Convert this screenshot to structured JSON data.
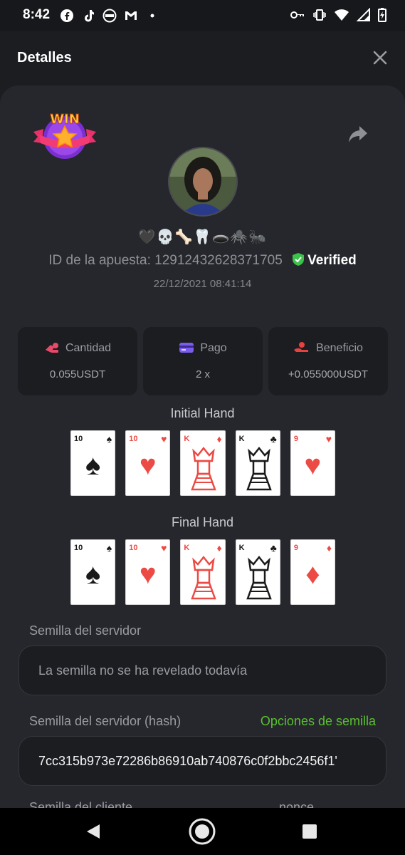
{
  "status_bar": {
    "time": "8:42"
  },
  "header": {
    "title": "Detalles"
  },
  "bet": {
    "emojis": "🖤💀🦴🦷🕳️🕷️🐜",
    "id_label": "ID de la apuesta: 12912432628371705",
    "verified_label": "Verified",
    "datetime": "22/12/2021 08:41:14"
  },
  "stats": [
    {
      "label": "Cantidad",
      "value": "0.055USDT",
      "icon": "coins-icon",
      "icon_color": "#e84a6a"
    },
    {
      "label": "Pago",
      "value": "2 x",
      "icon": "card-icon",
      "icon_color": "#7b5cf0"
    },
    {
      "label": "Beneficio",
      "value": "+0.055000USDT",
      "icon": "hand-coin-icon",
      "icon_color": "#e8413f"
    }
  ],
  "initial_hand": {
    "title": "Initial Hand",
    "cards": [
      {
        "rank": "10",
        "suit": "♠",
        "color": "black"
      },
      {
        "rank": "10",
        "suit": "♥",
        "color": "red"
      },
      {
        "rank": "K",
        "suit": "♦",
        "color": "red"
      },
      {
        "rank": "K",
        "suit": "♣",
        "color": "black"
      },
      {
        "rank": "9",
        "suit": "♥",
        "color": "red"
      }
    ]
  },
  "final_hand": {
    "title": "Final Hand",
    "cards": [
      {
        "rank": "10",
        "suit": "♠",
        "color": "black"
      },
      {
        "rank": "10",
        "suit": "♥",
        "color": "red"
      },
      {
        "rank": "K",
        "suit": "♦",
        "color": "red"
      },
      {
        "rank": "K",
        "suit": "♣",
        "color": "black"
      },
      {
        "rank": "9",
        "suit": "♦",
        "color": "red"
      }
    ]
  },
  "server_seed": {
    "label": "Semilla del servidor",
    "value": "La semilla no se ha revelado todavía"
  },
  "server_seed_hash": {
    "label": "Semilla del servidor (hash)",
    "link": "Opciones de semilla",
    "value": "7cc315b973e72286b86910ab740876c0f2bbc2456f1'"
  },
  "client_seed": {
    "label": "Semilla del cliente",
    "nonce_label": "nonce"
  },
  "colors": {
    "accent_green": "#59c02e",
    "background": "#1b1d21",
    "panel": "#25272c"
  }
}
